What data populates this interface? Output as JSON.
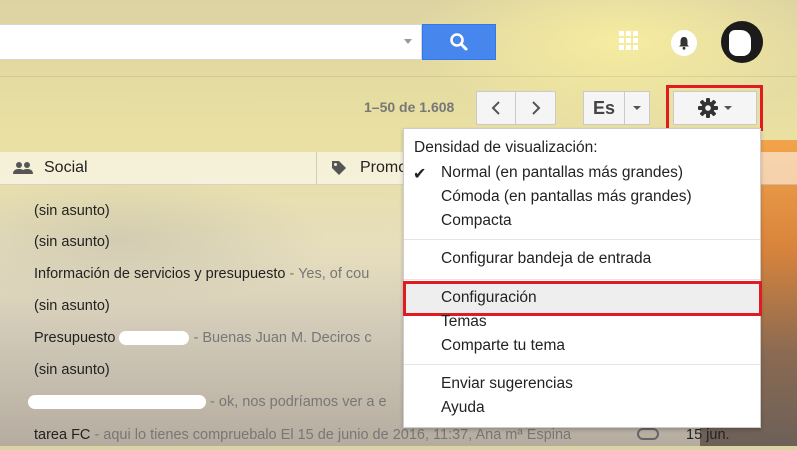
{
  "header": {
    "search": {
      "placeholder": "",
      "value": ""
    },
    "icons": {
      "search": "search-icon",
      "apps": "apps-grid-icon",
      "notifications": "bell-icon",
      "avatar": "user-avatar"
    }
  },
  "toolbar": {
    "pager_text": "1–50 de 1.608",
    "prev_icon": "chevron-left-icon",
    "next_icon": "chevron-right-icon",
    "language_label": "Es",
    "settings_icon": "gear-icon"
  },
  "tabs": [
    {
      "label": "Social",
      "icon": "people-icon"
    },
    {
      "label": "Promo",
      "icon": "tag-icon"
    }
  ],
  "emails": [
    {
      "subject": "(sin asunto)",
      "snippet": ""
    },
    {
      "subject": "(sin asunto)",
      "snippet": ""
    },
    {
      "subject": "Información de servicios y presupuesto",
      "snippet": " - Yes, of cou"
    },
    {
      "subject": "(sin asunto)",
      "snippet": ""
    },
    {
      "subject": "Presupuesto ",
      "snippet": " - Buenas Juan M. Deciros c"
    },
    {
      "subject": "(sin asunto)",
      "snippet": ""
    },
    {
      "subject": "",
      "snippet": " - ok, nos podríamos ver a e"
    },
    {
      "subject": "tarea FC",
      "snippet": " - aqui lo tienes compruebalo El 15 de junio de 2016, 11:37, Ana mª Espina",
      "date": "15 jun."
    }
  ],
  "settings_menu": {
    "density_header": "Densidad de visualización:",
    "density_options": [
      {
        "label": "Normal (en pantallas más grandes)",
        "checked": true
      },
      {
        "label": "Cómoda (en pantallas más grandes)",
        "checked": false
      },
      {
        "label": "Compacta",
        "checked": false
      }
    ],
    "configure_inbox": "Configurar bandeja de entrada",
    "configuration": "Configuración",
    "themes": "Temas",
    "share_theme": "Comparte tu tema",
    "send_feedback": "Enviar sugerencias",
    "help": "Ayuda"
  },
  "colors": {
    "highlight": "#e01b22",
    "search_button": "#4787ed"
  }
}
